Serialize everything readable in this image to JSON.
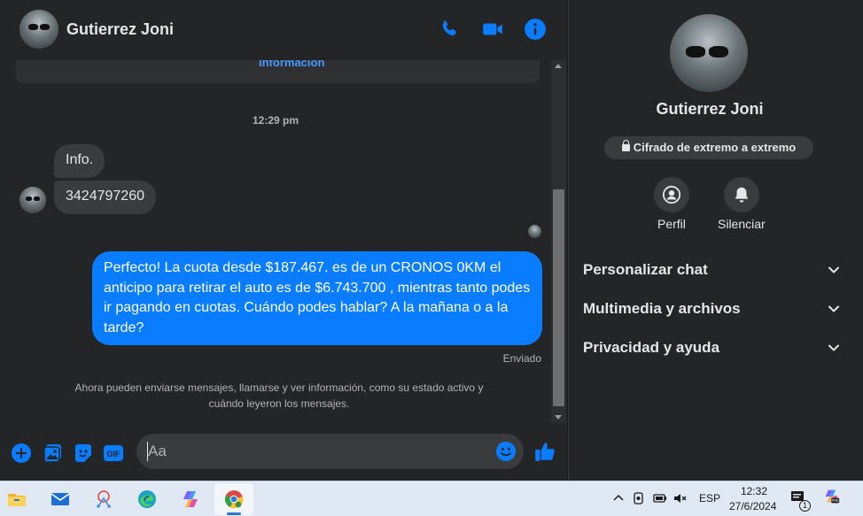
{
  "chat": {
    "contact_name": "Gutierrez Joni",
    "info_link": "información",
    "timestamp": "12:29 pm",
    "incoming": [
      "Info.",
      "3424797260"
    ],
    "outgoing": "Perfecto! La cuota desde $187.467. es de un CRONOS 0KM el anticipo para retirar el auto es de $6.743.700 , mientras tanto podes ir pagando en cuotas. Cuándo podes hablar? A la mañana o a la tarde?",
    "status": "Enviado",
    "system_note": "Ahora pueden enviarse mensajes, llamarse y ver información, como su estado activo y cuándo leyeron los mensajes.",
    "composer_placeholder": "Aa",
    "header_icons": [
      "phone-icon",
      "video-camera-icon",
      "info-icon"
    ],
    "composer_icons": [
      "plus-icon",
      "image-icon",
      "sticker-icon",
      "gif-icon",
      "emoji-icon",
      "thumbs-up-icon"
    ]
  },
  "panel": {
    "name": "Gutierrez Joni",
    "encryption": "Cifrado de extremo a extremo",
    "actions": [
      {
        "label": "Perfil",
        "icon": "profile-icon"
      },
      {
        "label": "Silenciar",
        "icon": "bell-icon"
      }
    ],
    "sections": [
      "Personalizar chat",
      "Multimedia y archivos",
      "Privacidad y ayuda"
    ]
  },
  "taskbar": {
    "apps": [
      "file-explorer-icon",
      "mail-icon",
      "snipping-tool-icon",
      "edge-icon",
      "copilot-icon",
      "chrome-icon"
    ],
    "language": "ESP",
    "time": "12:32",
    "date": "27/6/2024",
    "notification_count": "1"
  },
  "colors": {
    "accent": "#0a7cff",
    "background": "#242526",
    "bubble_incoming": "#3a3b3c"
  }
}
